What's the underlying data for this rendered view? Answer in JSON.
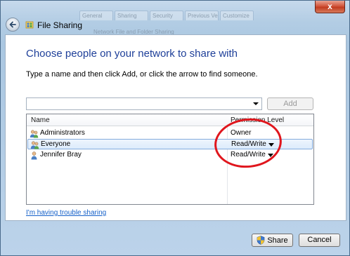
{
  "window": {
    "title": "File Sharing",
    "close_label": "x",
    "background_tabs": [
      "General",
      "Sharing",
      "Security",
      "Previous Versions",
      "Customize"
    ],
    "background_caption": "Network File and Folder Sharing"
  },
  "main": {
    "heading": "Choose people on your network to share with",
    "instruction": "Type a name and then click Add, or click the arrow to find someone.",
    "name_input": {
      "value": "",
      "placeholder": ""
    },
    "add_label": "Add"
  },
  "table": {
    "columns": {
      "name": "Name",
      "permission": "Permission Level"
    },
    "rows": [
      {
        "name": "Administrators",
        "permission": "Owner",
        "icon": "group-icon"
      },
      {
        "name": "Everyone",
        "permission": "Read/Write",
        "icon": "group-icon",
        "selected": true
      },
      {
        "name": "Jennifer Bray",
        "permission": "Read/Write",
        "icon": "user-icon"
      }
    ]
  },
  "links": {
    "trouble": "I'm having trouble sharing"
  },
  "footer": {
    "share_label": "Share",
    "cancel_label": "Cancel"
  },
  "colors": {
    "heading": "#1e3f99",
    "link": "#1460c9",
    "annotation": "#e0161d",
    "selection": "#dcebfc"
  }
}
